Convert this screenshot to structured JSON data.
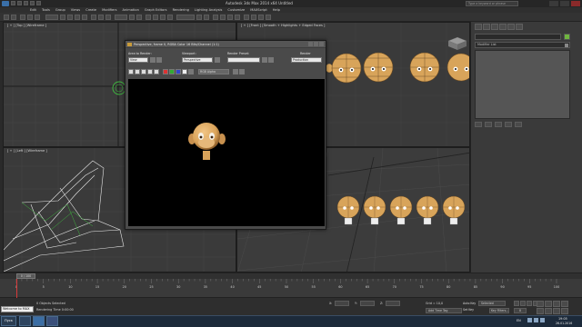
{
  "window": {
    "title": "Autodesk 3ds Max 2014 x64   Untitled",
    "help_search_placeholder": "Type a keyword or phrase"
  },
  "menu": {
    "items": [
      "Edit",
      "Tools",
      "Group",
      "Views",
      "Create",
      "Modifiers",
      "Animation",
      "Graph Editors",
      "Rendering",
      "Lighting Analysis",
      "Customize",
      "MAXScript",
      "Help"
    ]
  },
  "viewports": {
    "top_label": "[ + ] [Top ] [Wireframe ]",
    "front_label": "[ + ] [Front ] [Smooth + Highlights + Edged Faces ]",
    "left_label": "[ + ] [Left ] [Wireframe ]",
    "persp_label": ""
  },
  "command_panel": {
    "modifier_list": "Modifier List",
    "object_color": "#6fb53f"
  },
  "render_window": {
    "title": "Perspective, frame 0, RGBA Color 16 Bits/Channel (1:1)",
    "area_label": "Area to Render:",
    "area_value": "View",
    "viewport_label": "Viewport:",
    "viewport_value": "Perspective",
    "preset_label": "Render Preset:",
    "preset_value": "",
    "render_button": "Render",
    "render_mode": "Production",
    "channel_value": "RGB Alpha"
  },
  "timeline": {
    "slider_value": "0 / 100",
    "ruler_ticks": [
      "0",
      "5",
      "10",
      "15",
      "20",
      "25",
      "30",
      "35",
      "40",
      "45",
      "50",
      "55",
      "60",
      "65",
      "70",
      "75",
      "80",
      "85",
      "90",
      "95",
      "100"
    ]
  },
  "status": {
    "maxscript_text": "Welcome to MAX",
    "selection_text": "0 Objects Selected",
    "render_time": "Rendering Time  0:00:00",
    "x_label": "X:",
    "y_label": "Y:",
    "z_label": "Z:",
    "grid": "Grid = 10,0",
    "add_time_tag": "Add Time Tag",
    "auto_key": "Auto Key",
    "set_key": "Set Key",
    "selected_dropdown": "Selected",
    "key_filters": "Key Filters...",
    "current_frame": "0"
  },
  "taskbar": {
    "start_label": "Пуск",
    "language": "EN",
    "clock_time": "19:05",
    "clock_date": "26.01.2016"
  }
}
